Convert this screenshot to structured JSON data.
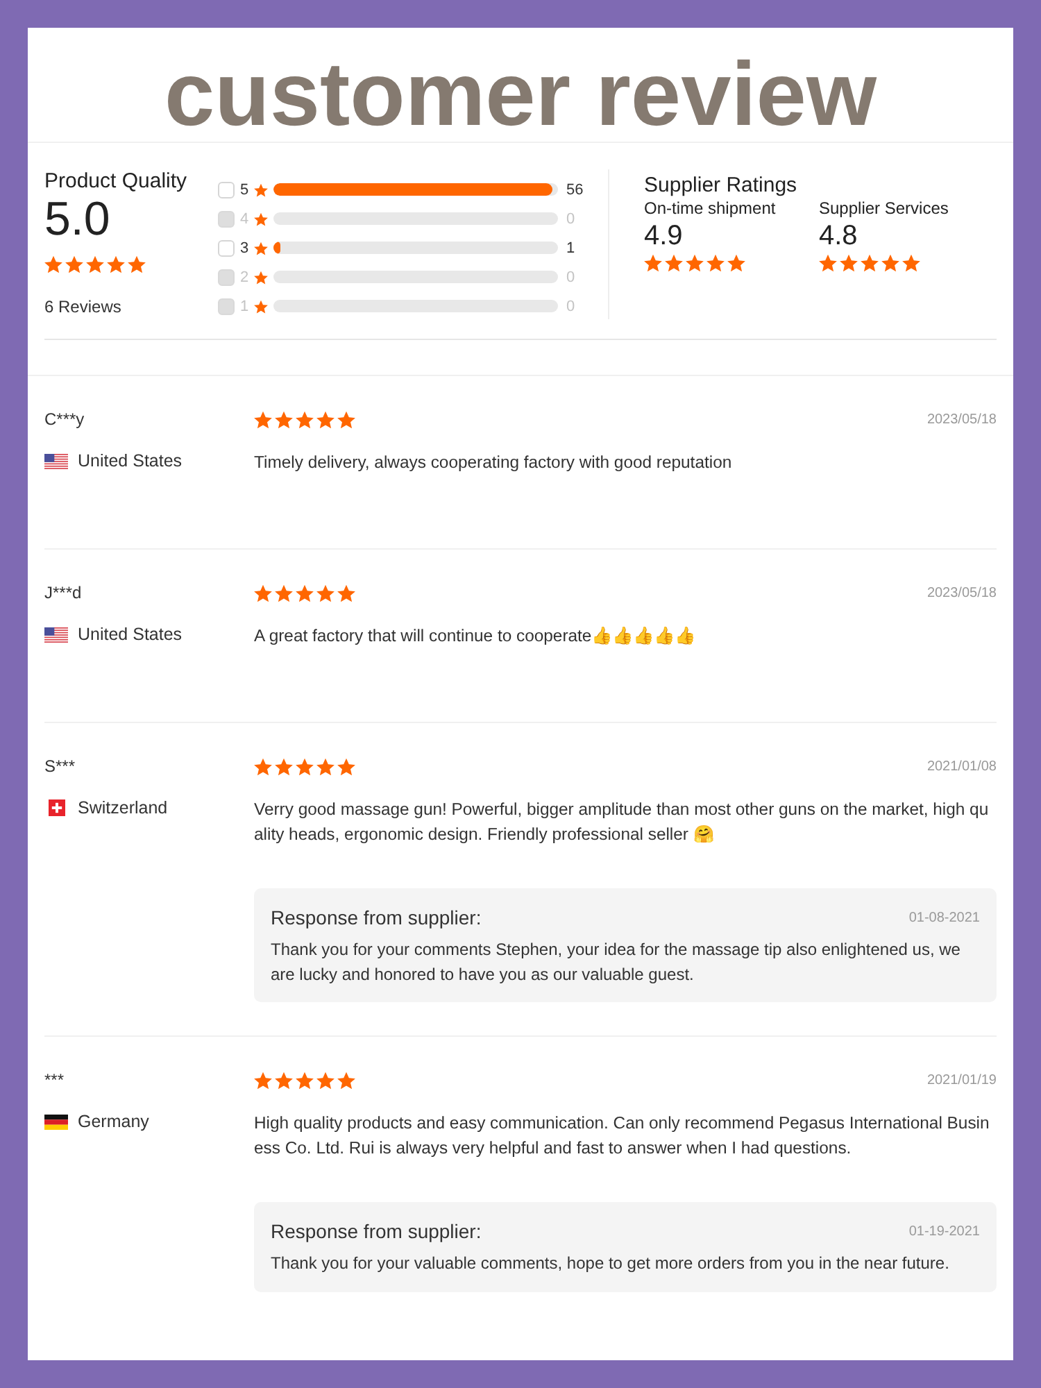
{
  "title": "customer review",
  "product_quality": {
    "label": "Product Quality",
    "score": "5.0",
    "stars": 5,
    "reviews_count": "6 Reviews"
  },
  "rating_breakdown": [
    {
      "label": "5",
      "count": "56",
      "level": 0.98,
      "checked": false,
      "disabled": false
    },
    {
      "label": "4",
      "count": "0",
      "checked": false,
      "disabled": true
    },
    {
      "label": "3",
      "count": "1",
      "level": 0.025,
      "checked": false,
      "disabled": false
    },
    {
      "label": "2",
      "count": "0",
      "checked": false,
      "disabled": true
    },
    {
      "label": "1",
      "count": "0",
      "checked": false,
      "disabled": true
    }
  ],
  "supplier_ratings": {
    "title": "Supplier Ratings",
    "metrics": [
      {
        "label": "On-time shipment",
        "score": "4.9",
        "stars": 5
      },
      {
        "label": "Supplier Services",
        "score": "4.8",
        "stars": 5
      }
    ]
  },
  "reviews": [
    {
      "name": "C***y",
      "flag": {
        "kind": "us"
      },
      "country": "United States",
      "stars": 5,
      "date": "2023/05/18",
      "text": "Timely delivery, always cooperating factory with good reputation"
    },
    {
      "name": "J***d",
      "flag": {
        "kind": "us"
      },
      "country": "United States",
      "stars": 5,
      "date": "2023/05/18",
      "text": "A great factory that will continue to cooperate👍👍👍👍👍"
    },
    {
      "name": "S***",
      "flag": {
        "kind": "ch"
      },
      "country": "Switzerland",
      "stars": 5,
      "date": "2021/01/08",
      "text": "Verry good massage gun! Powerful, bigger amplitude than most other guns on the market, high quality heads, ergonomic design. Friendly professional seller 🤗",
      "response": {
        "title": "Response from supplier:",
        "date": "01-08-2021",
        "text": "Thank you for your comments Stephen, your idea for the massage tip also enlightened us, we are lucky and honored to have you as our valuable guest."
      }
    },
    {
      "name": "***",
      "flag": {
        "kind": "de"
      },
      "country": "Germany",
      "stars": 5,
      "date": "2021/01/19",
      "text": "High quality products and easy communication. Can only recommend Pegasus International Business Co. Ltd. Rui is always very helpful and fast to answer when I had questions.",
      "response": {
        "title": "Response from supplier:",
        "date": "01-19-2021",
        "text": "Thank you for your valuable comments, hope to get more orders from you in the near future."
      }
    }
  ]
}
